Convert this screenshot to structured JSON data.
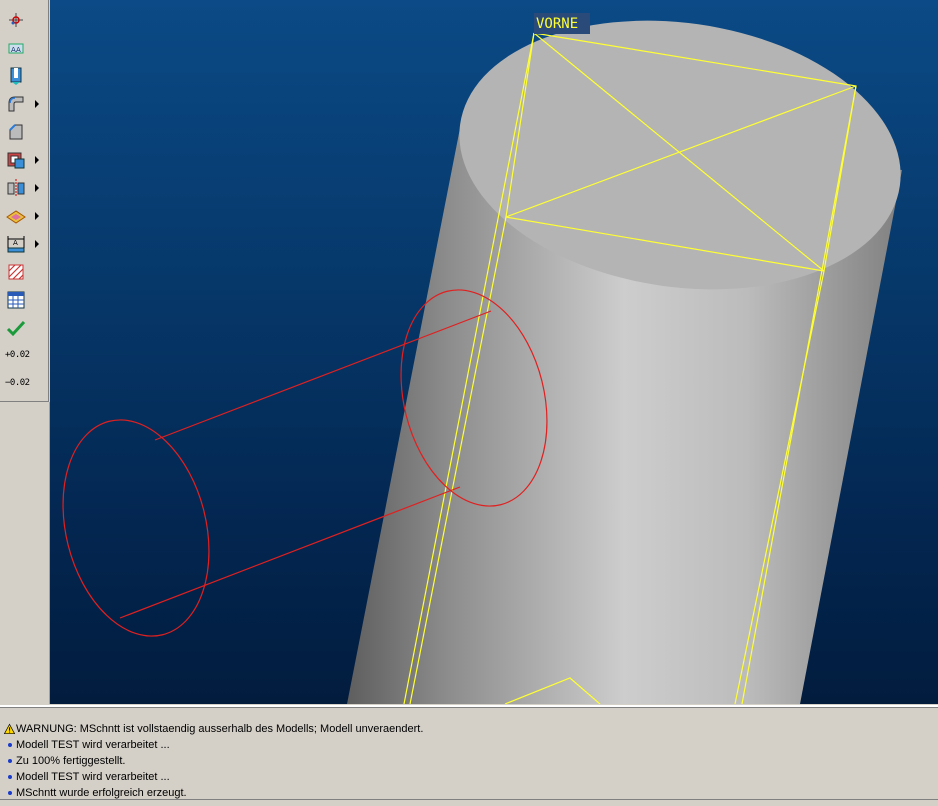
{
  "toolbar": {
    "tools": [
      {
        "name": "datum-point-icon",
        "has_submenu": false
      },
      {
        "name": "datum-plane-icon",
        "has_submenu": false
      },
      {
        "name": "hole-icon",
        "has_submenu": false
      },
      {
        "name": "round-icon",
        "has_submenu": true
      },
      {
        "name": "chamfer-icon",
        "has_submenu": false
      },
      {
        "name": "shell-icon",
        "has_submenu": true
      },
      {
        "name": "mirror-icon",
        "has_submenu": true
      },
      {
        "name": "surface-icon",
        "has_submenu": true
      },
      {
        "name": "dimension-icon",
        "has_submenu": true
      },
      {
        "name": "cross-section-hatch-icon",
        "has_submenu": false
      },
      {
        "name": "table-icon",
        "has_submenu": false
      },
      {
        "name": "checkmark-icon",
        "has_submenu": false
      }
    ],
    "tolerance_plus": "+0.02",
    "tolerance_minus": "−0.02"
  },
  "viewport": {
    "view_label": "VORNE",
    "colors": {
      "datum": "#ffff33",
      "section_circle": "#e02020",
      "model": "#c8c8c8"
    }
  },
  "messages": [
    {
      "type": "warning",
      "text": "WARNUNG: MSchntt ist vollstaendig ausserhalb des Modells; Modell unveraendert."
    },
    {
      "type": "info",
      "text": "Modell TEST wird verarbeitet ..."
    },
    {
      "type": "info",
      "text": "Zu 100% fertiggestellt."
    },
    {
      "type": "info",
      "text": "Modell TEST wird verarbeitet ..."
    },
    {
      "type": "info",
      "text": "MSchntt wurde erfolgreich erzeugt."
    }
  ]
}
